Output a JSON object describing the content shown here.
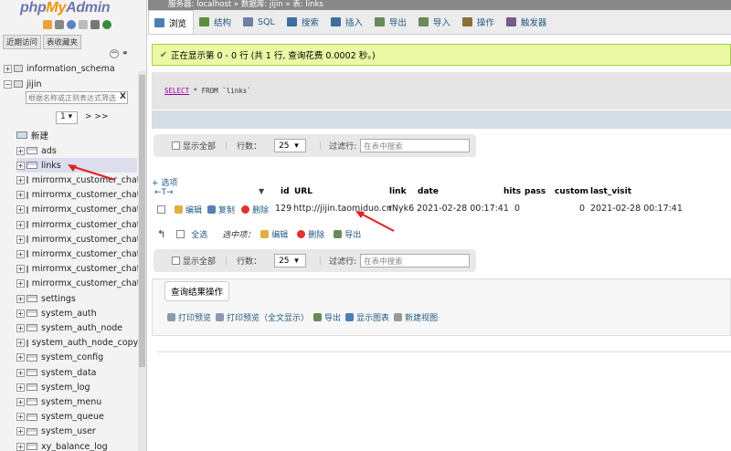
{
  "nav": {
    "logo_php": "php",
    "logo_my": "My",
    "logo_admin": "Admin",
    "tab_recent": "近期访问",
    "tab_favorites": "表收藏夹",
    "filter_placeholder": "根据名称或正则表达式筛选",
    "filter_clear": "X",
    "page": "1",
    "page_next": "> >>",
    "new_label": "新建",
    "db_information_schema": "information_schema",
    "db_jijin": "jijin",
    "tables": [
      "ads",
      "links",
      "mirrormx_customer_chat",
      "mirrormx_customer_chat",
      "mirrormx_customer_chat",
      "mirrormx_customer_chat",
      "mirrormx_customer_chat",
      "mirrormx_customer_chat",
      "mirrormx_customer_chat",
      "mirrormx_customer_chat",
      "settings",
      "system_auth",
      "system_auth_node",
      "system_auth_node_copy",
      "system_config",
      "system_data",
      "system_log",
      "system_menu",
      "system_queue",
      "system_user",
      "xy_balance_log"
    ]
  },
  "breadcrumb": "服务器: localhost » 数据库: jijin » 表: links",
  "menu": [
    {
      "label": "浏览",
      "color": "#4a7fb5"
    },
    {
      "label": "结构",
      "color": "#5b8f3e"
    },
    {
      "label": "SQL",
      "color": "#6d7fa3"
    },
    {
      "label": "搜索",
      "color": "#3f6fa0"
    },
    {
      "label": "插入",
      "color": "#3f6fa0"
    },
    {
      "label": "导出",
      "color": "#6a8a5b"
    },
    {
      "label": "导入",
      "color": "#6a8a5b"
    },
    {
      "label": "操作",
      "color": "#8a6f3a"
    },
    {
      "label": "触发器",
      "color": "#7a5a8a"
    }
  ],
  "success_msg": "正在显示第 0 - 0 行 (共 1 行, 查询花费 0.0002 秒。)",
  "sql": {
    "select": "SELECT",
    "rest": " * FROM `links`"
  },
  "navbar": {
    "show_all": "显示全部",
    "rows_label": "行数：",
    "rows_value": "25",
    "filter_label": "过滤行:",
    "filter_placeholder": "在表中搜索"
  },
  "options": "+ 选项",
  "table": {
    "headers": [
      "id",
      "URL",
      "link",
      "date",
      "hits",
      "pass",
      "custom",
      "last_visit"
    ],
    "row": {
      "edit": "编辑",
      "copy": "复制",
      "delete": "删除",
      "id": "129",
      "url": "http://jijin.taomiduo.cn",
      "link": "rNyk6",
      "date": "2021-02-28 00:17:41",
      "hits": "0",
      "pass": "",
      "custom": "0",
      "last_visit": "2021-02-28 00:17:41"
    }
  },
  "bulk": {
    "select_all": "全选",
    "with_selected": "选中项：",
    "edit": "编辑",
    "delete": "删除",
    "export": "导出"
  },
  "result_ops": {
    "title": "查询结果操作",
    "print": "打印预览",
    "print_full": "打印预览（全文显示）",
    "export": "导出",
    "chart": "显示图表",
    "view": "新建视图"
  }
}
